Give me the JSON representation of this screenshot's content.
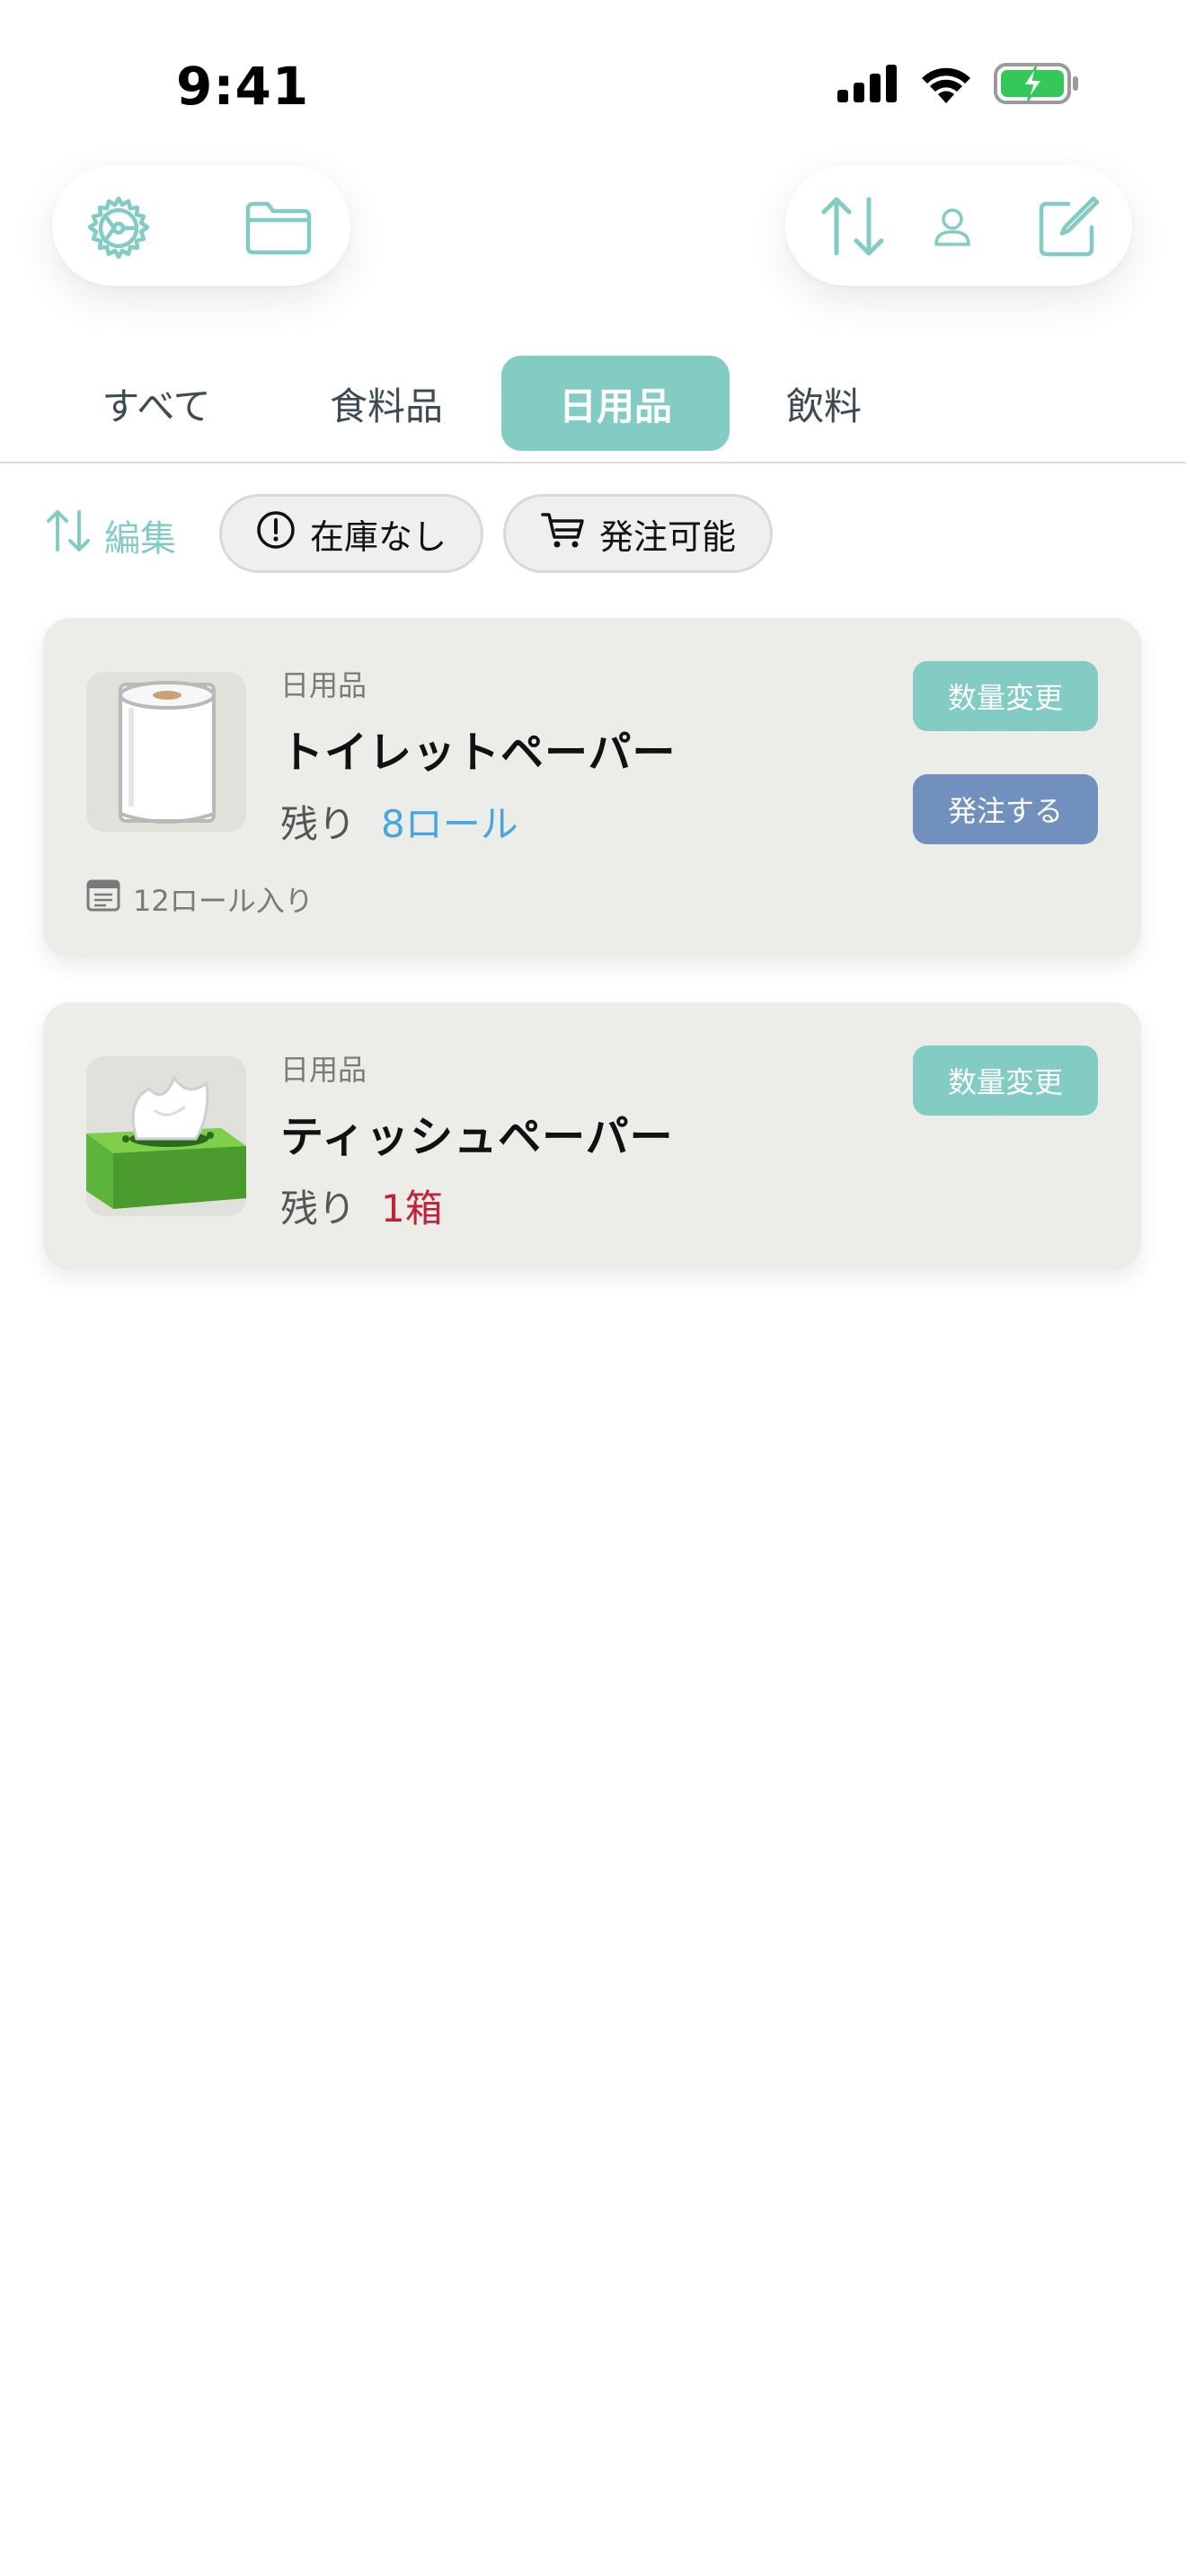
{
  "status_bar": {
    "time": "9:41"
  },
  "toolbar": {
    "left_icons": [
      "settings-gear-icon",
      "folder-icon"
    ],
    "right_icons": [
      "sort-by-user-icon",
      "compose-icon"
    ]
  },
  "tabs": [
    {
      "label": "すべて",
      "active": false
    },
    {
      "label": "食料品",
      "active": false
    },
    {
      "label": "日用品",
      "active": true
    },
    {
      "label": "飲料",
      "active": false
    }
  ],
  "filters": {
    "edit_label": "編集",
    "chips": [
      {
        "label": "在庫なし",
        "icon": "exclamation-circle-icon"
      },
      {
        "label": "発注可能",
        "icon": "cart-icon"
      }
    ]
  },
  "items": [
    {
      "category": "日用品",
      "name": "トイレットペーパー",
      "remaining_label": "残り",
      "quantity": "8ロール",
      "quantity_color": "#45a7df",
      "note": "12ロール入り",
      "buttons": [
        "数量変更",
        "発注する"
      ]
    },
    {
      "category": "日用品",
      "name": "ティッシュペーパー",
      "remaining_label": "残り",
      "quantity": "1箱",
      "quantity_color": "#c3213a",
      "buttons": [
        "数量変更"
      ]
    }
  ],
  "colors": {
    "accent": "#83ccc3",
    "order_button": "#7190bd",
    "card_bg": "#ecece8"
  }
}
